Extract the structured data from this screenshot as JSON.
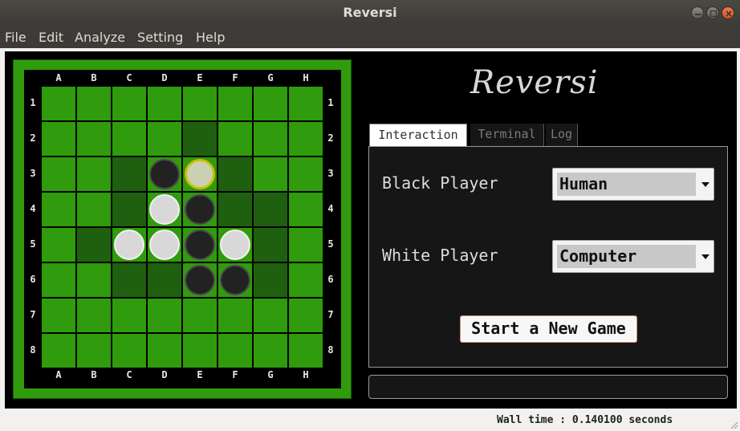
{
  "window": {
    "title": "Reversi"
  },
  "menu": [
    "File",
    "Edit",
    "Analyze",
    "Setting",
    "Help"
  ],
  "board": {
    "columns": [
      "A",
      "B",
      "C",
      "D",
      "E",
      "F",
      "G",
      "H"
    ],
    "rows": [
      "1",
      "2",
      "3",
      "4",
      "5",
      "6",
      "7",
      "8"
    ],
    "highlighted": [
      "E2",
      "C3",
      "F3",
      "C4",
      "F4",
      "G4",
      "B5",
      "G5",
      "C6",
      "D6",
      "G6"
    ],
    "discs": [
      {
        "square": "D3",
        "color": "black"
      },
      {
        "square": "E3",
        "color": "white",
        "last_move": true
      },
      {
        "square": "D4",
        "color": "white"
      },
      {
        "square": "E4",
        "color": "black"
      },
      {
        "square": "C5",
        "color": "white"
      },
      {
        "square": "D5",
        "color": "white"
      },
      {
        "square": "E5",
        "color": "black"
      },
      {
        "square": "F5",
        "color": "white"
      },
      {
        "square": "E6",
        "color": "black"
      },
      {
        "square": "F6",
        "color": "black"
      }
    ],
    "colors": {
      "green": "#2f9b0d",
      "highlight": "#1f6010",
      "frame": "#000000"
    }
  },
  "logo": "Reversi",
  "tabs": [
    {
      "label": "Interaction",
      "active": true
    },
    {
      "label": "Terminal",
      "active": false
    },
    {
      "label": "Log",
      "active": false
    }
  ],
  "interaction": {
    "black_player_label": "Black Player",
    "black_player_value": "Human",
    "white_player_label": "White Player",
    "white_player_value": "Computer",
    "new_game_label": "Start a New Game"
  },
  "status": {
    "wall_time": "Wall time : 0.140100 seconds"
  }
}
